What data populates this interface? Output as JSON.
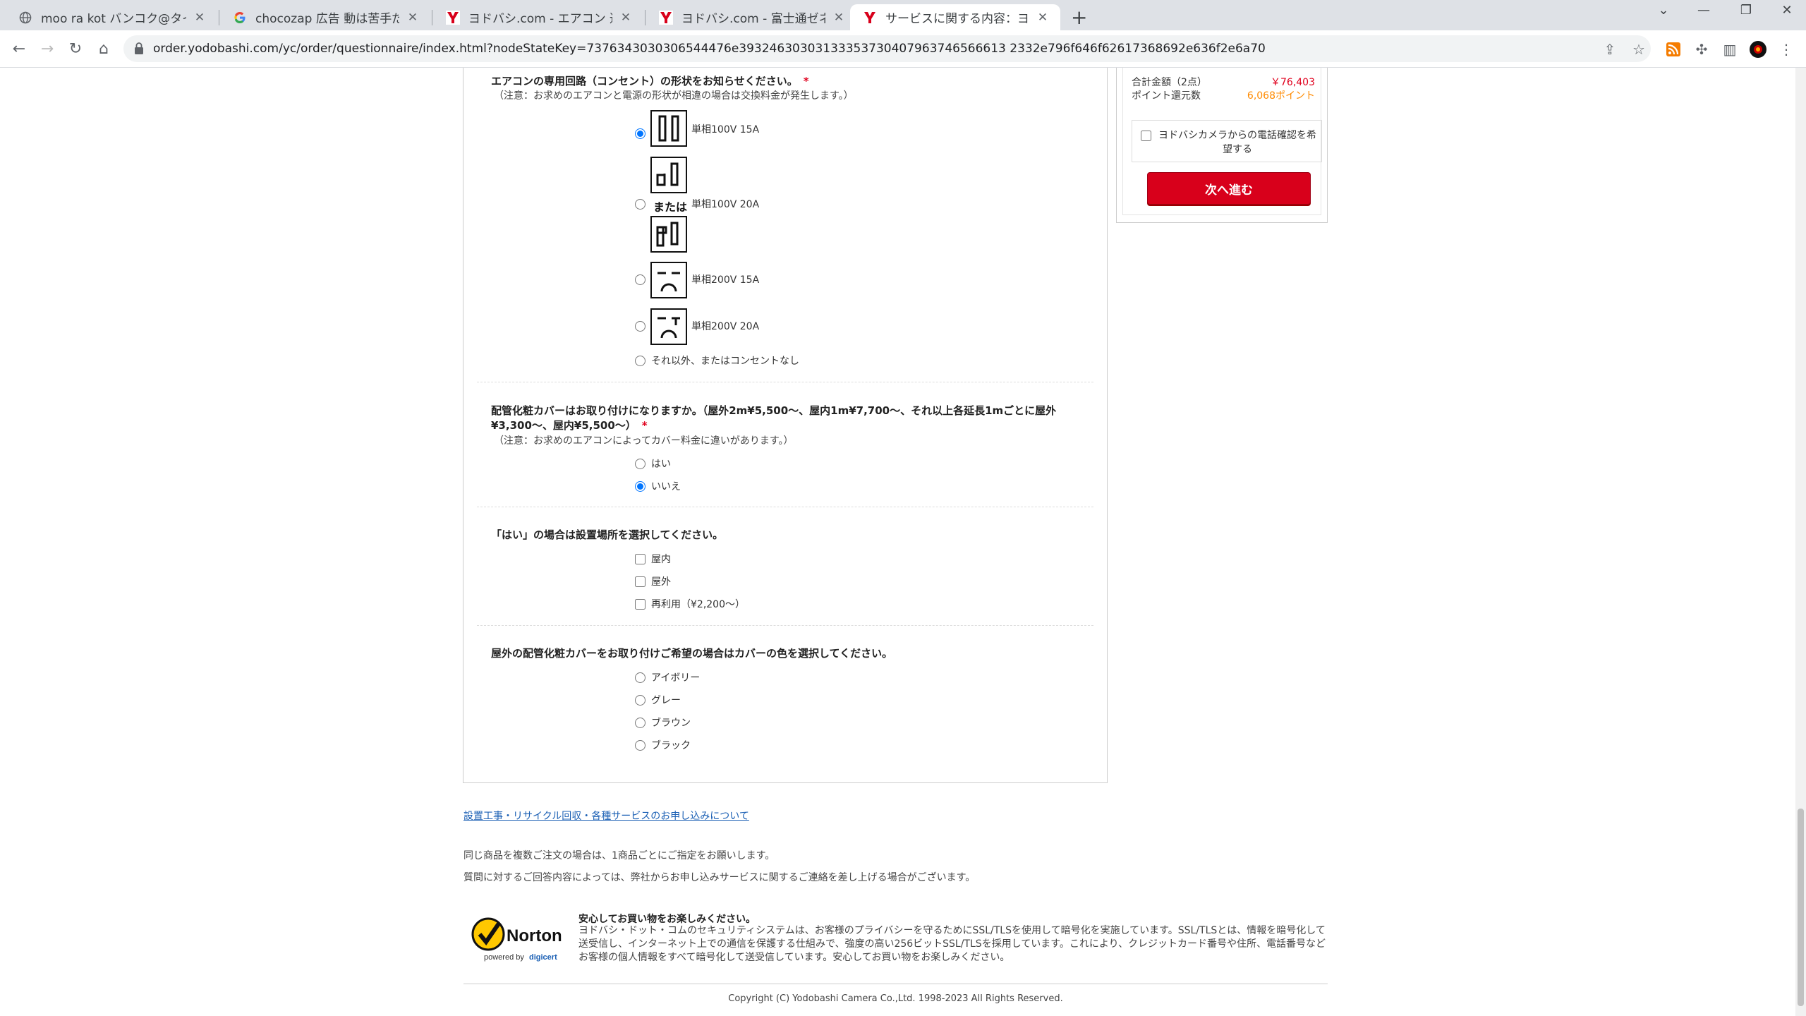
{
  "browser": {
    "tabs": [
      {
        "title": "moo ra kot バンコク@タイ在住／非"
      },
      {
        "title": "chocozap 広告 動は苦手だけどス"
      },
      {
        "title": "ヨドバシ.com - エアコン 通販【全品"
      },
      {
        "title": "ヨドバシ.com - 富士通ゼネラル FUJ"
      },
      {
        "title": "サービスに関する内容：ヨドバシ.ドッ"
      }
    ],
    "url": "order.yodobashi.com/yc/order/questionnaire/index.html?nodeStateKey=7376343030306544476e39324630303133353730407963746566613 2332e796f646f62617368692e636f2e6a70"
  },
  "form": {
    "q1": {
      "label": "エアコンの専用回路（コンセント）の形状をお知らせください。",
      "required": "*",
      "note": "（注意：お求めのエアコンと電源の形状が相違の場合は交換料金が発生します。）",
      "or_label": "または",
      "options": [
        "単相100V 15A",
        "単相100V 20A",
        "単相200V 15A",
        "単相200V 20A",
        "それ以外、またはコンセントなし"
      ]
    },
    "q2": {
      "label": "配管化粧カバーはお取り付けになりますか。（屋外2m¥5,500〜、屋内1m¥7,700〜、それ以上各延長1mごとに屋外¥3,300〜、屋内¥5,500〜）",
      "required": "*",
      "note": "（注意：お求めのエアコンによってカバー料金に違いがあります。）",
      "options": [
        "はい",
        "いいえ"
      ]
    },
    "q3": {
      "label": "「はい」の場合は設置場所を選択してください。",
      "options": [
        "屋内",
        "屋外",
        "再利用（¥2,200〜）"
      ]
    },
    "q4": {
      "label": "屋外の配管化粧カバーをお取り付けご希望の場合はカバーの色を選択してください。",
      "options": [
        "アイボリー",
        "グレー",
        "ブラウン",
        "ブラック"
      ]
    }
  },
  "footer": {
    "link": "設置工事・リサイクル回収・各種サービスのお申し込みについて",
    "info1": "同じ商品を複数ご注文の場合は、1商品ごとにご指定をお願いします。",
    "info2": "質問に対するご回答内容によっては、弊社からお申し込みサービスに関するご連絡を差し上げる場合がございます。",
    "security_title": "安心してお買い物をお楽しみください。",
    "security_body": "ヨドバシ・ドット・コムのセキュリティシステムは、お客様のプライバシーを守るためにSSL/TLSを使用して暗号化を実施しています。SSL/TLSとは、情報を暗号化して送受信し、インターネット上での通信を保護する仕組みで、強度の高い256ビットSSL/TLSを採用しています。これにより、クレジットカード番号や住所、電話番号などお客様の個人情報をすべて暗号化して送受信しています。安心してお買い物をお楽しみください。",
    "norton_brand": "Norton",
    "norton_sub": "powered by",
    "norton_digicert": "digicert",
    "copyright": "Copyright (C) Yodobashi Camera Co.,Ltd. 1998-2023 All Rights Reserved."
  },
  "sidebar": {
    "total_label": "合計金額（2点）",
    "total_value": "￥76,403",
    "points_label": "ポイント還元数",
    "points_value": "6,068ポイント",
    "tel_confirm": "ヨドバシカメラからの電話確認を希望する",
    "next_button": "次へ進む"
  },
  "colors": {
    "accent": "#d8001b",
    "points": "#ff8a00",
    "link": "#1a5fb4"
  }
}
